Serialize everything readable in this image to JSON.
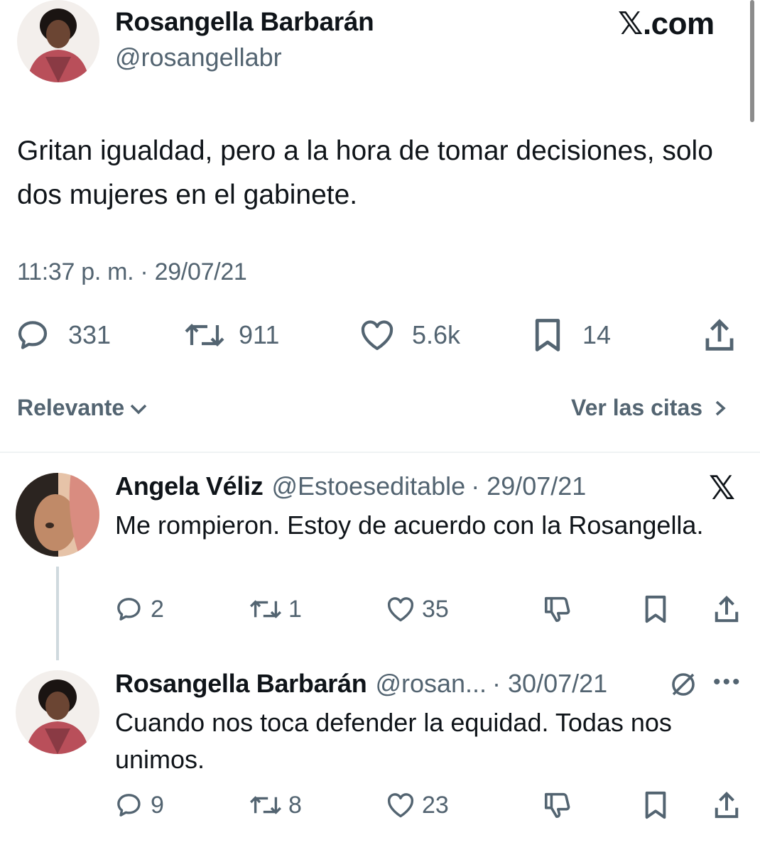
{
  "brand": {
    "label": "𝕏.com"
  },
  "main_tweet": {
    "author_name": "Rosangella Barbarán",
    "author_handle": "@rosangellabr",
    "text": "Gritan igualdad, pero a la hora de tomar decisiones, solo dos mujeres en el gabinete.",
    "timestamp": "11:37 p. m. · 29/07/21",
    "stats": {
      "replies": "331",
      "reposts": "911",
      "likes": "5.6k",
      "bookmarks": "14"
    }
  },
  "filters": {
    "sort_label": "Relevante",
    "quotes_label": "Ver las citas"
  },
  "replies": [
    {
      "author_name": "Angela Véliz",
      "author_handle": "@Estoeseditable",
      "date": "· 29/07/21",
      "text": "Me rompieron. Estoy de acuerdo con la Rosangella.",
      "stats": {
        "replies": "2",
        "reposts": "1",
        "likes": "35"
      }
    },
    {
      "author_name": "Rosangella Barbarán",
      "author_handle": "@rosan...",
      "date": "· 30/07/21",
      "text": "Cuando nos toca defender la equidad. Todas nos unimos.",
      "stats": {
        "replies": "9",
        "reposts": "8",
        "likes": "23"
      }
    }
  ],
  "icons": {
    "reply": "speech-bubble-icon",
    "repost": "repost-arrows-icon",
    "like": "heart-icon",
    "bookmark": "bookmark-icon",
    "share": "share-upload-icon",
    "dislike": "thumbs-down-icon",
    "close": "x-logo-icon",
    "more": "more-dots-icon",
    "muted": "slash-circle-icon"
  },
  "colors": {
    "text": "#0f1419",
    "secondary": "#536471",
    "divider": "#eff3f4",
    "thread_line": "#cfd9de"
  }
}
